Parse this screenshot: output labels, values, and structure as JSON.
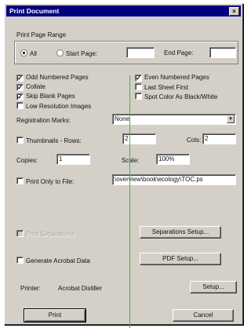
{
  "window": {
    "title": "Print Document",
    "close_glyph": "×"
  },
  "page_range": {
    "label": "Print Page Range",
    "all_label": "All",
    "start_label": "Start Page:",
    "start_value": "",
    "end_label": "End Page:",
    "end_value": "",
    "selected": "All"
  },
  "options": {
    "odd": {
      "label": "Odd Numbered Pages",
      "checked": true
    },
    "even": {
      "label": "Even Numbered Pages",
      "checked": true
    },
    "collate": {
      "label": "Collate",
      "checked": true
    },
    "last_first": {
      "label": "Last Sheet First",
      "checked": false
    },
    "skip_blank": {
      "label": "Skip Blank Pages",
      "checked": true
    },
    "spot_color": {
      "label": "Spot Color As Black/White",
      "checked": false
    },
    "low_res": {
      "label": "Low Resolution Images",
      "checked": false
    }
  },
  "registration": {
    "label": "Registration Marks:",
    "value": "None"
  },
  "thumbnails": {
    "label": "Thumbnails - Rows:",
    "rows": "2",
    "cols_label": "Cols:",
    "cols": "2"
  },
  "copies": {
    "label": "Copies:",
    "value": "1",
    "scale_label": "Scale:",
    "scale_value": "100%"
  },
  "print_to_file": {
    "label": "Print Only to File:",
    "path": "\\overview\\book\\ecology\\TOC.ps"
  },
  "separations": {
    "label": "Print Separations",
    "button": "Separations Setup..."
  },
  "acrobat": {
    "label": "Generate Acrobat Data",
    "button": "PDF Setup..."
  },
  "printer": {
    "label": "Printer:",
    "name": "Acrobat Distiller",
    "setup_button": "Setup..."
  },
  "footer": {
    "print_button": "Print",
    "cancel_button": "Cancel"
  },
  "glyphs": {
    "check": "✓",
    "dropdown": "▼"
  }
}
